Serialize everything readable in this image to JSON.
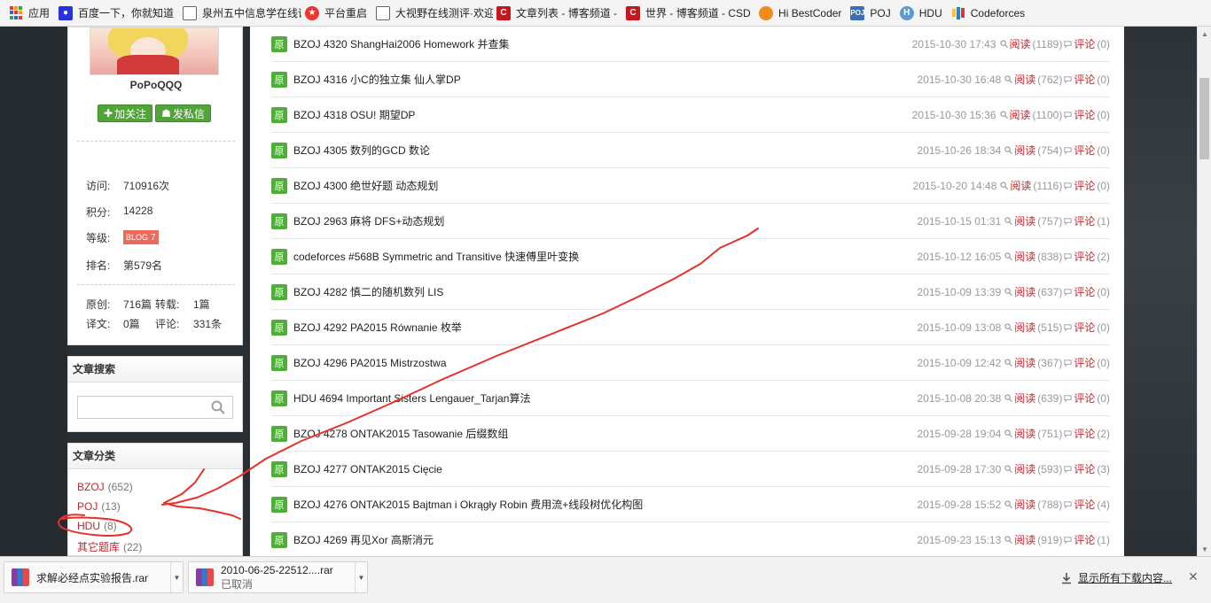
{
  "bookmarks": [
    {
      "label": "应用",
      "icon": "apps-icon"
    },
    {
      "label": "百度一下，你就知道",
      "icon": "baidu-paw-icon"
    },
    {
      "label": "泉州五中信息学在线评",
      "icon": "document-icon"
    },
    {
      "label": "平台重启",
      "icon": "red-star-icon"
    },
    {
      "label": "大视野在线测评·欢迎",
      "icon": "document-icon"
    },
    {
      "label": "文章列表 - 博客频道 -",
      "icon": "csdn-icon"
    },
    {
      "label": "世界 - 博客频道 - CSD",
      "icon": "csdn-icon"
    },
    {
      "label": "Hi BestCoder",
      "icon": "firefox-icon"
    },
    {
      "label": "POJ",
      "icon": "poj-icon"
    },
    {
      "label": "HDU",
      "icon": "hdu-icon"
    },
    {
      "label": "Codeforces",
      "icon": "codeforces-icon"
    }
  ],
  "profile": {
    "username": "PoPoQQQ",
    "follow_label": "加关注",
    "message_label": "发私信",
    "stats": [
      {
        "label": "访问:",
        "value": "710916次"
      },
      {
        "label": "积分:",
        "value": "14228"
      },
      {
        "label": "等级:",
        "badge": "BLOG",
        "level": "7"
      },
      {
        "label": "排名:",
        "value": "第579名"
      }
    ],
    "counts": {
      "original_label": "原创:",
      "original": "716篇",
      "repost_label": "转载:",
      "repost": "1篇",
      "translate_label": "译文:",
      "translate": "0篇",
      "comment_label": "评论:",
      "comment": "331条"
    }
  },
  "search": {
    "title": "文章搜索",
    "placeholder": ""
  },
  "categories": {
    "title": "文章分类",
    "items": [
      {
        "name": "BZOJ",
        "count": "(652)"
      },
      {
        "name": "POJ",
        "count": "(13)"
      },
      {
        "name": "HDU",
        "count": "(8)"
      },
      {
        "name": "其它题库",
        "count": "(22)"
      }
    ]
  },
  "list": {
    "badge": "原",
    "read_label": "阅读",
    "comment_label": "评论",
    "articles": [
      {
        "title": "BZOJ 4320 ShangHai2006 Homework 并查集",
        "date": "2015-10-30 17:43",
        "reads": "(1189)",
        "comments": "(0)"
      },
      {
        "title": "BZOJ 4316 小C的独立集 仙人掌DP",
        "date": "2015-10-30 16:48",
        "reads": "(762)",
        "comments": "(0)"
      },
      {
        "title": "BZOJ 4318 OSU! 期望DP",
        "date": "2015-10-30 15:36",
        "reads": "(1100)",
        "comments": "(0)"
      },
      {
        "title": "BZOJ 4305 数列的GCD 数论",
        "date": "2015-10-26 18:34",
        "reads": "(754)",
        "comments": "(0)"
      },
      {
        "title": "BZOJ 4300 绝世好题 动态规划",
        "date": "2015-10-20 14:48",
        "reads": "(1116)",
        "comments": "(0)"
      },
      {
        "title": "BZOJ 2963 麻将 DFS+动态规划",
        "date": "2015-10-15 01:31",
        "reads": "(757)",
        "comments": "(1)"
      },
      {
        "title": "codeforces #568B Symmetric and Transitive 快速傅里叶变换",
        "date": "2015-10-12 16:05",
        "reads": "(838)",
        "comments": "(2)"
      },
      {
        "title": "BZOJ 4282 慎二的随机数列 LIS",
        "date": "2015-10-09 13:39",
        "reads": "(637)",
        "comments": "(0)"
      },
      {
        "title": "BZOJ 4292 PA2015 Równanie 枚举",
        "date": "2015-10-09 13:08",
        "reads": "(515)",
        "comments": "(0)"
      },
      {
        "title": "BZOJ 4296 PA2015 Mistrzostwa",
        "date": "2015-10-09 12:42",
        "reads": "(367)",
        "comments": "(0)"
      },
      {
        "title": "HDU 4694 Important Sisters Lengauer_Tarjan算法",
        "date": "2015-10-08 20:38",
        "reads": "(639)",
        "comments": "(0)"
      },
      {
        "title": "BZOJ 4278 ONTAK2015 Tasowanie 后缀数组",
        "date": "2015-09-28 19:04",
        "reads": "(751)",
        "comments": "(2)"
      },
      {
        "title": "BZOJ 4277 ONTAK2015 Cięcie",
        "date": "2015-09-28 17:30",
        "reads": "(593)",
        "comments": "(3)"
      },
      {
        "title": "BZOJ 4276 ONTAK2015 Bajtman i Okrągły Robin 费用流+线段树优化构图",
        "date": "2015-09-28 15:52",
        "reads": "(788)",
        "comments": "(4)"
      },
      {
        "title": "BZOJ 4269 再见Xor 高斯消元",
        "date": "2015-09-23 15:13",
        "reads": "(919)",
        "comments": "(1)"
      }
    ]
  },
  "downloads": [
    {
      "name": "求解必经点实验报告.rar",
      "status": ""
    },
    {
      "name": "2010-06-25-22512....rar",
      "status": "已取消"
    }
  ],
  "show_all_label": "显示所有下载内容...",
  "colors": {
    "accent_red": "#c1272d",
    "badge_green": "#4fae37",
    "annotation_red": "#e8302a"
  }
}
